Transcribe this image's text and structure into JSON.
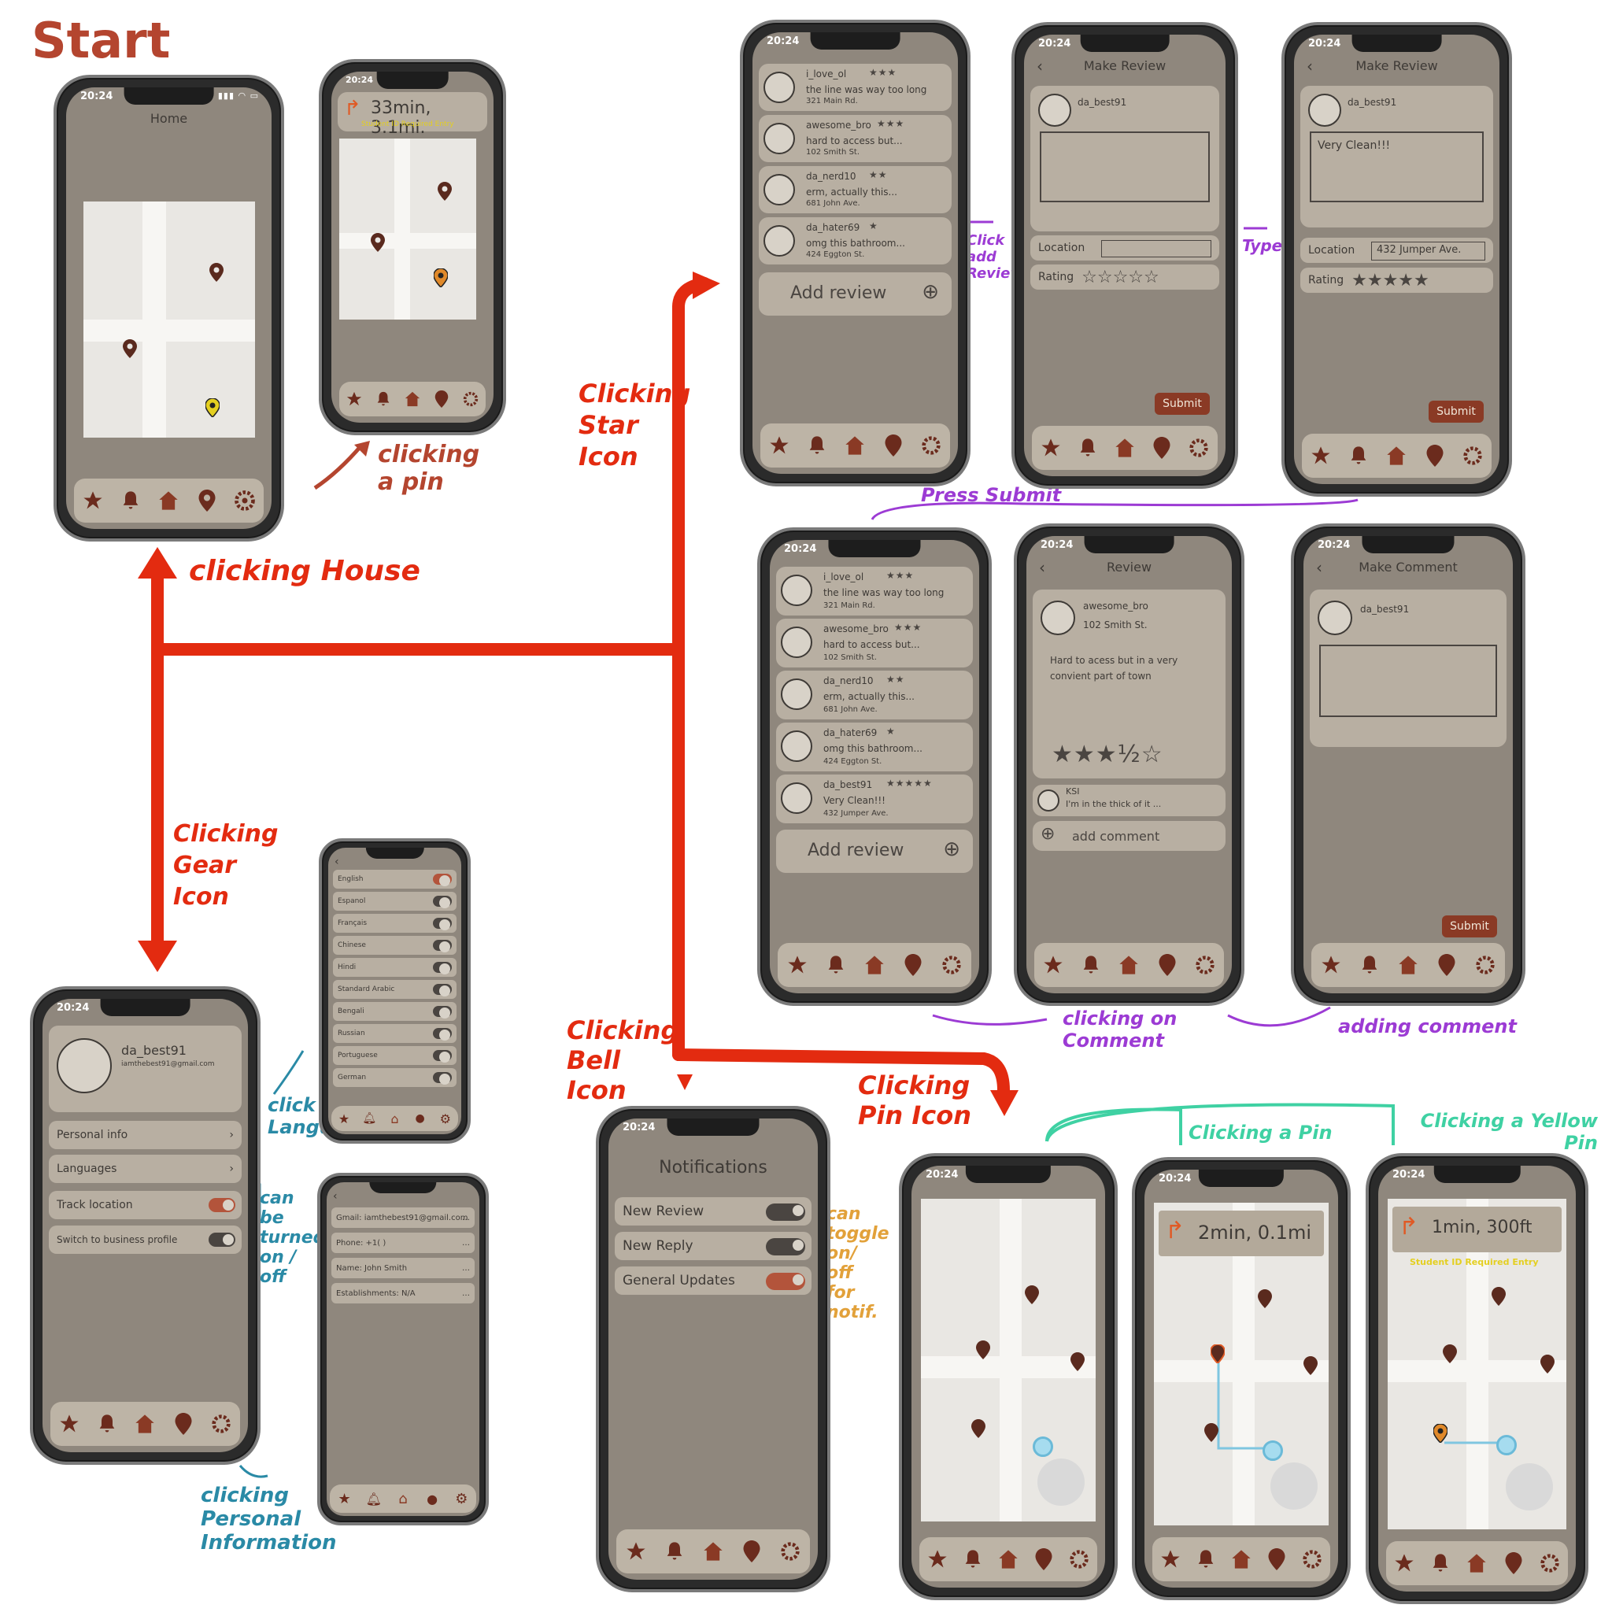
{
  "colors": {
    "accent_red": "#e32b10",
    "purple": "#9c3bd4",
    "teal": "#2a8aa6",
    "green": "#3fd1a3",
    "orange": "#e2a13a",
    "brown": "#6b2b1d",
    "screen": "#8f877d",
    "card": "#b8afa2"
  },
  "start_label": "Start",
  "status_time": "20:24",
  "tab_icons": [
    "star-icon",
    "bell-icon",
    "house-icon",
    "pin-icon",
    "gear-icon"
  ],
  "home": {
    "title": "Home"
  },
  "route1": {
    "eta": "33min, 3.1mi.",
    "note": "Student ID Required Entry"
  },
  "route2": {
    "eta": "2min, 0.1mi"
  },
  "route3": {
    "eta": "1min, 300ft",
    "note": "Student ID Required Entry"
  },
  "reviews": [
    {
      "user": "i_love_ol",
      "stars": "★★★",
      "text": "the line was way too long",
      "addr": "321 Main Rd."
    },
    {
      "user": "awesome_bro",
      "stars": "★★★",
      "text": "hard to access but...",
      "addr": "102 Smith St."
    },
    {
      "user": "da_nerd10",
      "stars": "★★",
      "text": "erm, actually this...",
      "addr": "681 John Ave."
    },
    {
      "user": "da_hater69",
      "stars": "★",
      "text": "omg this bathroom...",
      "addr": "424 Eggton St."
    }
  ],
  "new_review": {
    "user": "da_best91",
    "stars": "★★★★★",
    "text": "Very Clean!!!",
    "addr": "432 Jumper Ave."
  },
  "add_review": "Add review",
  "make_review": {
    "title": "Make Review",
    "user": "da_best91",
    "location_label": "Location",
    "rating_label": "Rating",
    "typed_text": "Very Clean!!!",
    "typed_location": "432 Jumper Ave.",
    "submit": "Submit",
    "empty_stars": "☆☆☆☆☆",
    "full_stars": "★★★★★"
  },
  "review_detail": {
    "title": "Review",
    "user": "awesome_bro",
    "addr": "102 Smith St.",
    "text": "Hard to acess but in a very convient part of town",
    "stars": "★★★½☆",
    "comment_user": "KSI",
    "comment_text": "I'm in the thick of it ...",
    "add_comment": "add comment"
  },
  "make_comment": {
    "title": "Make Comment",
    "user": "da_best91",
    "submit": "Submit"
  },
  "profile": {
    "user": "da_best91",
    "email": "iamthebest91@gmail.com",
    "items": [
      "Personal info",
      "Languages",
      "Track location",
      "Switch to business profile"
    ]
  },
  "languages": [
    "English",
    "Espanol",
    "Français",
    "Chinese",
    "Hindi",
    "Standard Arabic",
    "Bengali",
    "Russian",
    "Portuguese",
    "German"
  ],
  "personal": [
    {
      "label": "Gmail: iamthebest91@gmail.com"
    },
    {
      "label": "Phone: +1(   )"
    },
    {
      "label": "Name: John Smith"
    },
    {
      "label": "Establishments: N/A"
    }
  ],
  "notifications": {
    "title": "Notifications",
    "items": [
      "New Review",
      "New Reply",
      "General Updates"
    ]
  },
  "annotations": {
    "clicking_a_pin": "clicking a pin",
    "clicking_house": "clicking House",
    "clicking_star": "Clicking Star Icon",
    "clicking_gear": "Clicking Gear Icon",
    "clicking_bell": "Clicking Bell Icon",
    "clicking_pin_icon": "Clicking Pin Icon",
    "click_add_review": "Click add Review",
    "type": "Type",
    "press_submit": "Press Submit",
    "clicking_on_comment": "clicking on Comment",
    "adding_comment": "adding comment",
    "click_languages": "click Languages",
    "can_be_turned": "can be turned on / off",
    "clicking_personal": "clicking Personal Information",
    "can_toggle": "can toggle on/ off for notif.",
    "clicking_a_pin2": "Clicking a Pin",
    "clicking_yellow_pin": "Clicking a Yellow Pin"
  }
}
